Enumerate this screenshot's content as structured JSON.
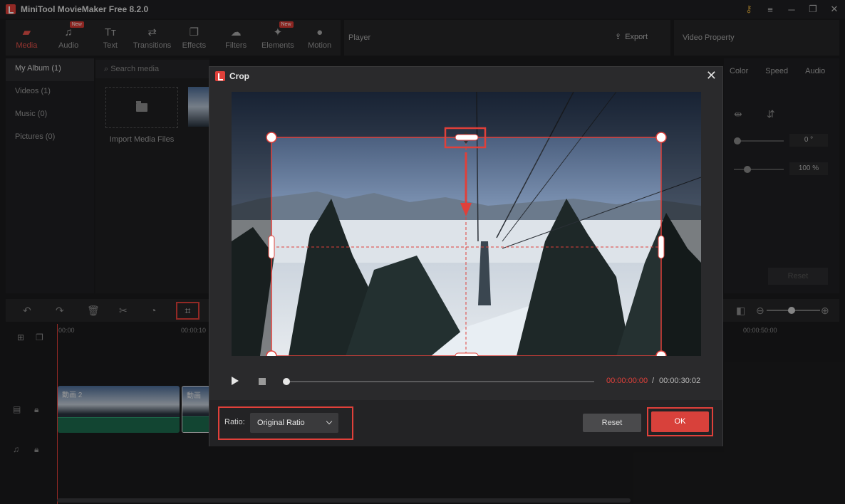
{
  "window": {
    "title": "MiniTool MovieMaker Free 8.2.0",
    "controls": [
      "⚷",
      "≡",
      "─",
      "❐",
      "✕"
    ]
  },
  "toolbar": {
    "items": [
      {
        "label": "Media",
        "icon": "folder-icon",
        "glyph": "▰",
        "active": true
      },
      {
        "label": "Audio",
        "icon": "music-icon",
        "glyph": "♫",
        "badge": "New"
      },
      {
        "label": "Text",
        "icon": "text-icon",
        "glyph": "Tт"
      },
      {
        "label": "Transitions",
        "icon": "transitions-icon",
        "glyph": "⇄"
      },
      {
        "label": "Effects",
        "icon": "effects-icon",
        "glyph": "❐"
      },
      {
        "label": "Filters",
        "icon": "filters-icon",
        "glyph": "☁"
      },
      {
        "label": "Elements",
        "icon": "elements-icon",
        "glyph": "✦",
        "badge": "New"
      },
      {
        "label": "Motion",
        "icon": "motion-icon",
        "glyph": "●"
      }
    ]
  },
  "player": {
    "title": "Player",
    "export_label": "Export"
  },
  "video_property": {
    "title": "Video Property",
    "tabs": [
      "Color",
      "Speed",
      "Audio"
    ],
    "rotate_value": "0 °",
    "scale_value": "100 %",
    "reset_label": "Reset"
  },
  "album": {
    "items": [
      "My Album (1)",
      "Videos (1)",
      "Music (0)",
      "Pictures (0)"
    ],
    "search_placeholder": "Search media",
    "import_label": "Import Media Files"
  },
  "timeline": {
    "times": [
      "00:00",
      "00:00:10",
      "00:00:50:00"
    ],
    "clip_name": "動画 2",
    "clip2_name": "動画"
  },
  "crop_dialog": {
    "title": "Crop",
    "close_glyph": "✕",
    "current_time": "00:00:00:00",
    "separator": "/",
    "total_time": "00:00:30:02",
    "ratio_label": "Ratio:",
    "ratio_value": "Original Ratio",
    "reset_label": "Reset",
    "ok_label": "OK",
    "progress": 0
  },
  "colors": {
    "accent": "#e0403a",
    "ok_button": "#d8413b",
    "dialog_bg": "#2a2a2c"
  }
}
